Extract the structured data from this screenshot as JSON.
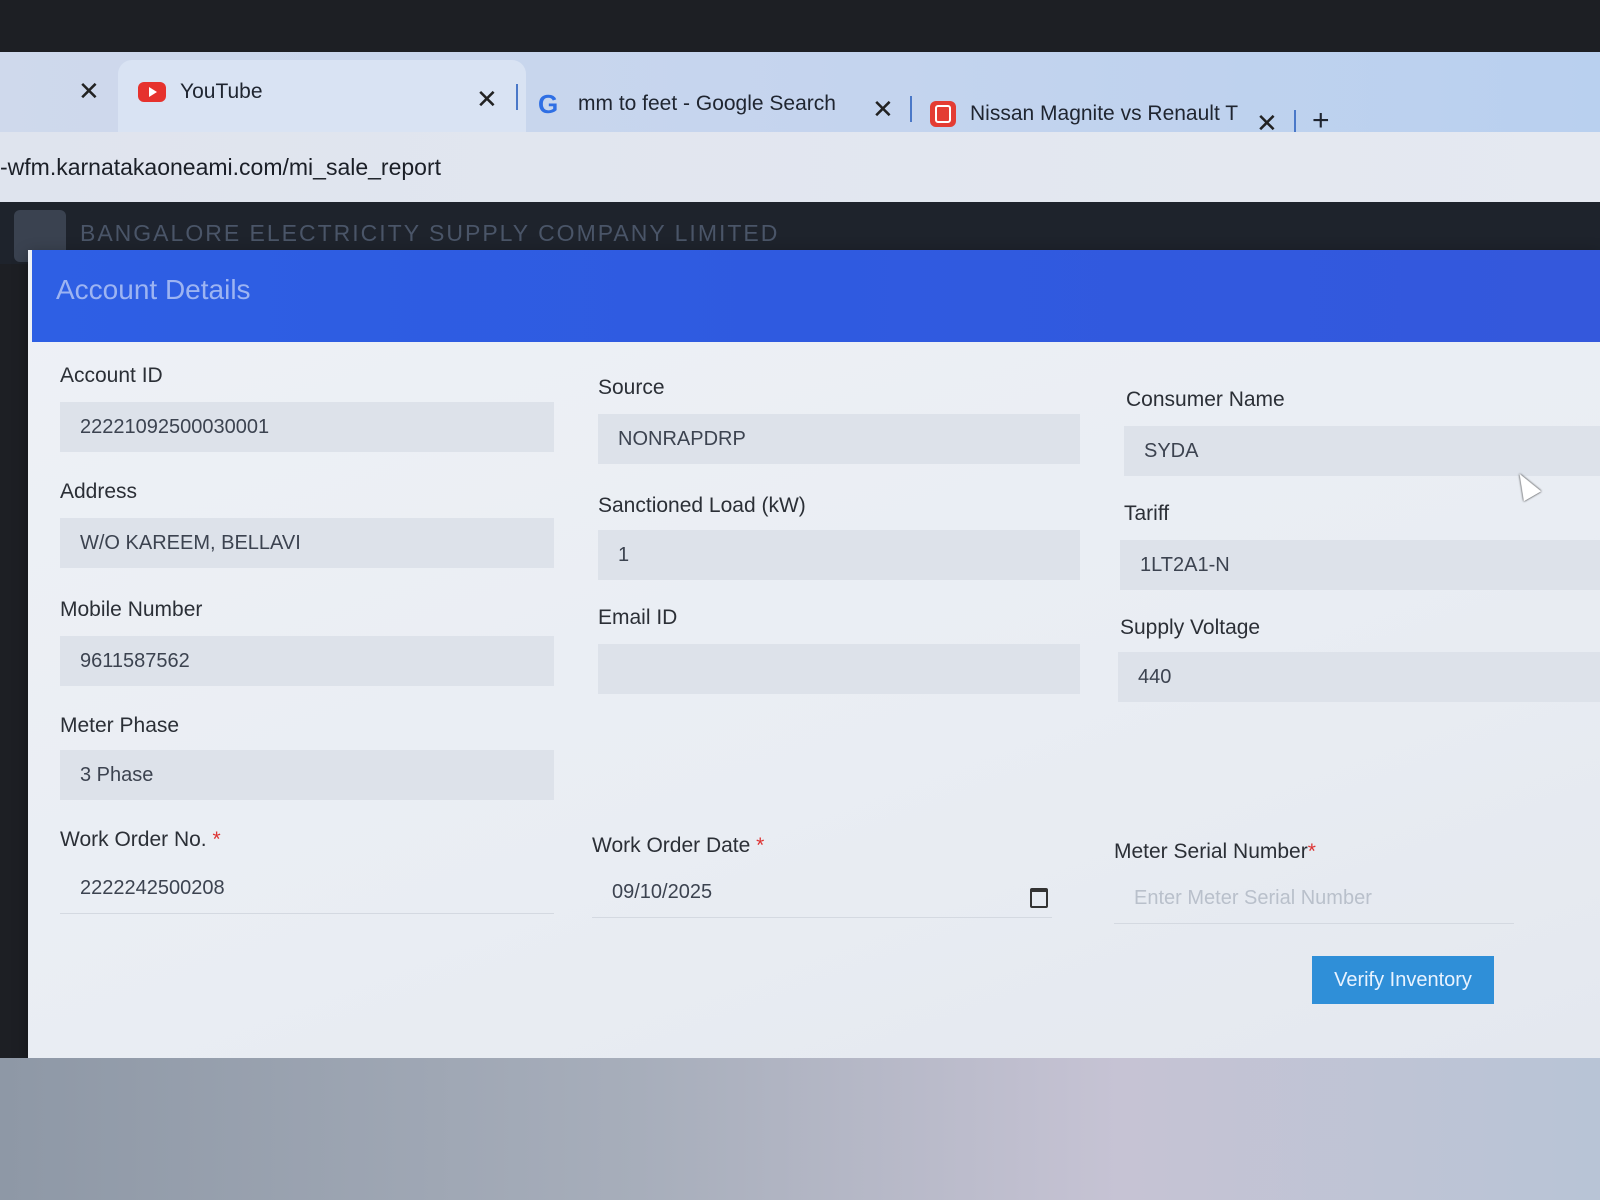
{
  "browser": {
    "tabs": [
      {
        "label": "",
        "active": false
      },
      {
        "label": "YouTube",
        "icon": "youtube-icon",
        "active": true
      },
      {
        "label": "mm to feet - Google Search",
        "icon": "google-icon",
        "active": false
      },
      {
        "label": "Nissan Magnite vs Renault Tribe",
        "icon": "carwale-icon",
        "active": false
      }
    ],
    "close_glyph": "✕",
    "new_tab_glyph": "+",
    "url": "-wfm.karnatakaoneami.com/mi_sale_report"
  },
  "app": {
    "company_name": "BANGALORE ELECTRICITY SUPPLY COMPANY LIMITED"
  },
  "modal": {
    "title": "Account Details",
    "fields": {
      "account_id": {
        "label": "Account ID",
        "value": "22221092500030001"
      },
      "source": {
        "label": "Source",
        "value": "NONRAPDRP"
      },
      "consumer_name": {
        "label": "Consumer Name",
        "value": "SYDA"
      },
      "address": {
        "label": "Address",
        "value": "W/O KAREEM, BELLAVI"
      },
      "sanctioned_load": {
        "label": "Sanctioned Load (kW)",
        "value": "1"
      },
      "tariff": {
        "label": "Tariff",
        "value": "1LT2A1-N"
      },
      "mobile": {
        "label": "Mobile Number",
        "value": "9611587562"
      },
      "email": {
        "label": "Email ID",
        "value": ""
      },
      "supply_voltage": {
        "label": "Supply Voltage",
        "value": "440"
      },
      "meter_phase": {
        "label": "Meter Phase",
        "value": "3 Phase"
      },
      "work_order_no": {
        "label": "Work Order No.",
        "value": "2222242500208"
      },
      "work_order_date": {
        "label": "Work Order Date",
        "value": "09/10/2025"
      },
      "meter_serial": {
        "label": "Meter Serial Number",
        "placeholder": "Enter Meter Serial Number"
      }
    },
    "required_mark": "*",
    "verify_button": "Verify Inventory"
  },
  "colors": {
    "modal_header": "#2e5fe4",
    "button": "#2f8fd8",
    "required": "#dd3333"
  }
}
